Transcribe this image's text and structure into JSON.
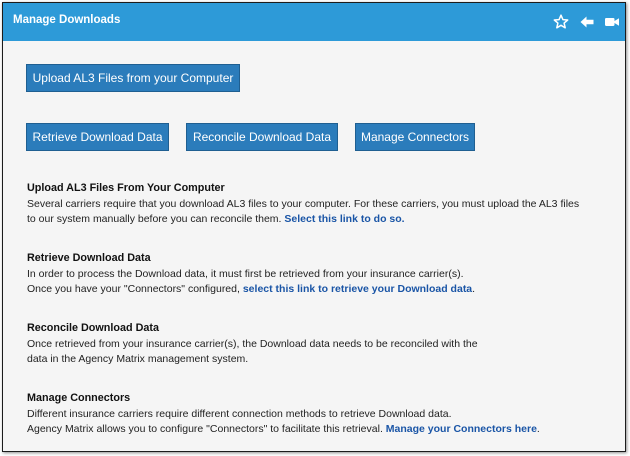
{
  "window": {
    "title": "Manage Downloads"
  },
  "icons": [
    "star-icon",
    "arrow-left-icon",
    "video-camera-icon"
  ],
  "colors": {
    "header": "#2d9ad8",
    "button": "#2b7cbb",
    "link": "#1a55a6"
  },
  "buttons": {
    "upload": "Upload AL3 Files from your Computer",
    "retrieve": "Retrieve Download Data",
    "reconcile": "Reconcile Download Data",
    "connectors": "Manage Connectors"
  },
  "sections": {
    "upload": {
      "title": "Upload AL3 Files From Your Computer",
      "line1": "Several carriers require that you download AL3 files to your computer. For these carriers, you must upload the AL3 files",
      "line2": "to our system manually before you can reconcile them.",
      "link": "Select this link to do so."
    },
    "retrieve": {
      "title": "Retrieve Download Data",
      "line1": "In order to process the Download data, it must first be retrieved from your insurance carrier(s).",
      "line2": "Once you have your \"Connectors\" configured,",
      "link": "select this link to retrieve your Download data",
      "after": "."
    },
    "reconcile": {
      "title": "Reconcile Download Data",
      "line1": "Once retrieved from your insurance carrier(s), the Download data needs to be reconciled with the",
      "line2": "data in the Agency Matrix management system."
    },
    "connectors": {
      "title": "Manage Connectors",
      "line1": "Different insurance carriers require different connection methods to retrieve Download data.",
      "line2": "Agency Matrix allows you to configure \"Connectors\" to facilitate this retrieval.",
      "link": "Manage your Connectors here",
      "after": "."
    }
  }
}
